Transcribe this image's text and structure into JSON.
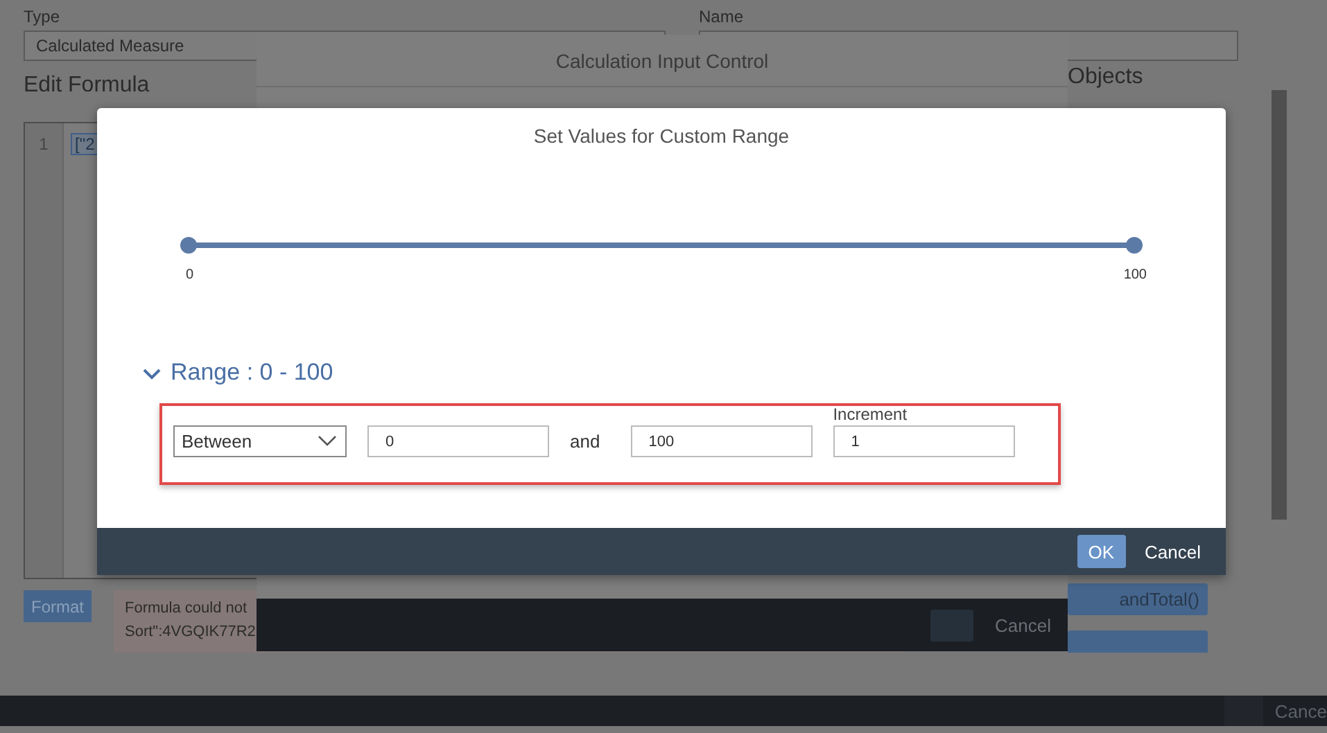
{
  "background_page": {
    "type_label": "Type",
    "type_value": "Calculated Measure",
    "name_label": "Name",
    "edit_formula_title": "Edit Formula",
    "line_number": "1",
    "formula_code": "[\"2",
    "format_button": "Format",
    "error_lines": [
      "Formula could not",
      "Sort\":4VGQIK77R2"
    ],
    "objects_title": "Objects",
    "function_button": "andTotal()",
    "bottom_bar_button": "Cance"
  },
  "input_control_dialog": {
    "title": "Calculation Input Control",
    "cancel_button": "Cancel"
  },
  "custom_range_dialog": {
    "title": "Set Values for Custom Range",
    "slider": {
      "low": {
        "level": 0
      },
      "high": {
        "level": 1
      },
      "min_label": "0",
      "max_label": "100"
    },
    "range": {
      "title": "Range : 0 - 100",
      "expanded": true,
      "highlighted": true,
      "operator": "Between",
      "from": "0",
      "joiner": "and",
      "to": "100",
      "increment_label": "Increment",
      "increment": "1"
    },
    "buttons": [
      {
        "label": "OK",
        "primary": true
      },
      {
        "label": "Cancel",
        "primary": false
      }
    ]
  }
}
